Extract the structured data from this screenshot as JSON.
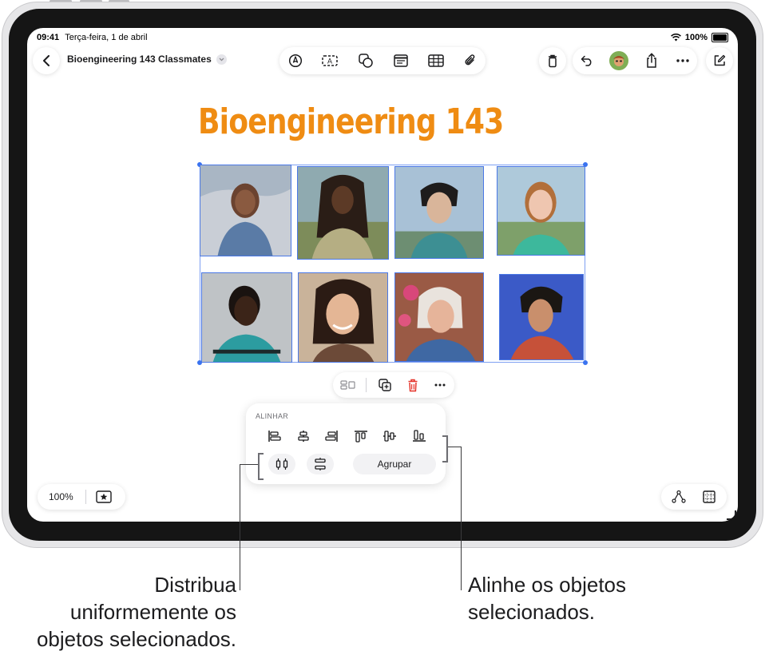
{
  "status_bar": {
    "time": "09:41",
    "date": "Terça-feira, 1 de abril",
    "battery": "100%"
  },
  "toolbar": {
    "board_title": "Bioengineering 143 Classmates",
    "center_tools": [
      "pen-icon",
      "text-box-icon",
      "shapes-icon",
      "note-icon",
      "table-icon",
      "attachment-icon"
    ],
    "right_tools": [
      "trash-icon",
      "undo-icon",
      "avatar",
      "share-icon",
      "more-icon"
    ],
    "compose_icon": "compose-icon"
  },
  "canvas": {
    "title": "Bioengineering 143",
    "title_color": "#ef8c13",
    "photos_count": 8
  },
  "context_menu": {
    "items": [
      "distribute-mode-icon",
      "duplicate-icon",
      "delete-icon",
      "more-icon"
    ],
    "delete_color": "#e5332a"
  },
  "align_panel": {
    "label": "ALINHAR",
    "align_buttons": [
      "align-left-icon",
      "align-center-horizontal-icon",
      "align-right-icon",
      "align-top-icon",
      "align-middle-vertical-icon",
      "align-bottom-icon"
    ],
    "distribute_buttons": [
      "distribute-horizontal-icon",
      "distribute-vertical-icon"
    ],
    "group_label": "Agrupar"
  },
  "bottom_bar": {
    "zoom": "100%"
  },
  "callouts": {
    "left": [
      "Distribua",
      "uniformemente os",
      "objetos selecionados."
    ],
    "right": [
      "Alinhe os objetos",
      "selecionados."
    ]
  },
  "accent_color": "#3a73f0"
}
